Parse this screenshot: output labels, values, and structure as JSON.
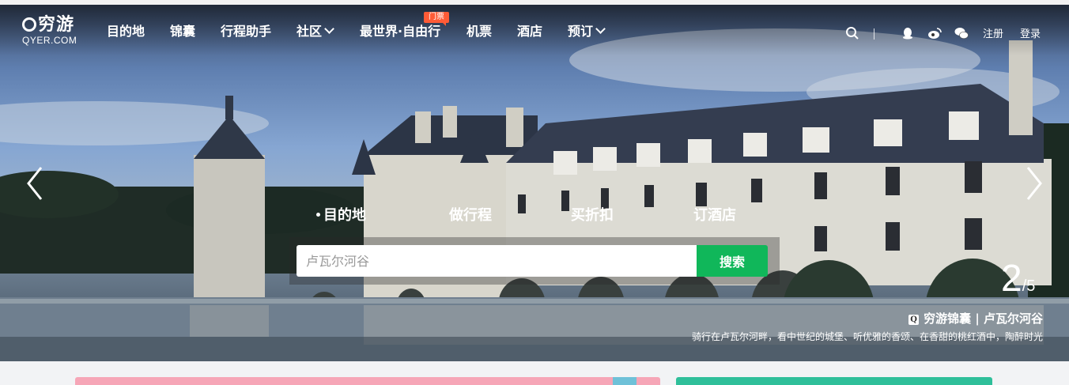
{
  "brand": {
    "name_cn": "穷游",
    "name_en": "QYER.COM"
  },
  "nav": {
    "items": [
      {
        "label": "目的地",
        "dropdown": false
      },
      {
        "label": "锦囊",
        "dropdown": false
      },
      {
        "label": "行程助手",
        "dropdown": false
      },
      {
        "label": "社区",
        "dropdown": true
      },
      {
        "label": "最世界·自由行",
        "dropdown": false
      },
      {
        "label": "机票",
        "dropdown": false
      },
      {
        "label": "酒店",
        "dropdown": false
      },
      {
        "label": "预订",
        "dropdown": true
      }
    ],
    "badge": "门票"
  },
  "toolbar": {
    "icons": [
      "search-icon",
      "qq-icon",
      "weibo-icon",
      "wechat-icon"
    ],
    "register_label": "注册",
    "login_label": "登录"
  },
  "search": {
    "tabs": [
      "目的地",
      "做行程",
      "买折扣",
      "订酒店"
    ],
    "active_tab": 0,
    "placeholder": "卢瓦尔河谷",
    "button_label": "搜索"
  },
  "slider": {
    "current": "2",
    "total": "/5",
    "caption_title": "穷游锦囊 | 卢瓦尔河谷",
    "caption_badge": "Q",
    "caption_sub": "骑行在卢瓦尔河畔，看中世纪的城堡、听优雅的香颂、在香甜的桃红酒中，陶醉时光"
  },
  "colors": {
    "accent_green": "#10b75a",
    "badge_orange": "#ff5b36",
    "text_white": "#ffffff"
  }
}
